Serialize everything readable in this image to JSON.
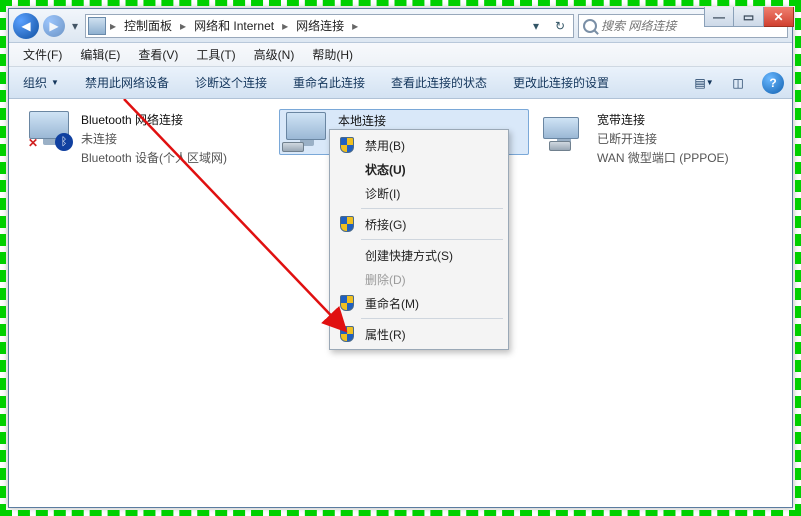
{
  "window_controls": {
    "min": "—",
    "max": "▭",
    "close": "✕"
  },
  "nav": {
    "back": "◀",
    "fwd": "▶",
    "drop": "▾",
    "refresh": "↻",
    "hist": "▾",
    "crumbs": [
      "控制面板",
      "网络和 Internet",
      "网络连接"
    ],
    "sep": "▸"
  },
  "search": {
    "placeholder": "搜索 网络连接"
  },
  "menubar": [
    "文件(F)",
    "编辑(E)",
    "查看(V)",
    "工具(T)",
    "高级(N)",
    "帮助(H)"
  ],
  "cmdbar": {
    "organize": "组织",
    "actions": [
      "禁用此网络设备",
      "诊断这个连接",
      "重命名此连接",
      "查看此连接的状态",
      "更改此连接的设置"
    ],
    "help": "?"
  },
  "connections": [
    {
      "title": "Bluetooth 网络连接",
      "status": "未连接",
      "device": "Bluetooth 设备(个人区域网)",
      "badges": {
        "cross": "✕",
        "bt": "⌘"
      }
    },
    {
      "title": "本地连接",
      "status": "",
      "device": ""
    },
    {
      "title": "宽带连接",
      "status": "已断开连接",
      "device": "WAN 微型端口 (PPPOE)"
    }
  ],
  "context_menu": [
    {
      "label": "禁用(B)",
      "shield": true
    },
    {
      "label": "状态(U)",
      "bold": true
    },
    {
      "label": "诊断(I)"
    },
    {
      "sep": true
    },
    {
      "label": "桥接(G)",
      "shield": true
    },
    {
      "sep": true
    },
    {
      "label": "创建快捷方式(S)"
    },
    {
      "label": "删除(D)",
      "disabled": true
    },
    {
      "label": "重命名(M)",
      "shield": true
    },
    {
      "sep": true
    },
    {
      "label": "属性(R)",
      "shield": true
    }
  ]
}
